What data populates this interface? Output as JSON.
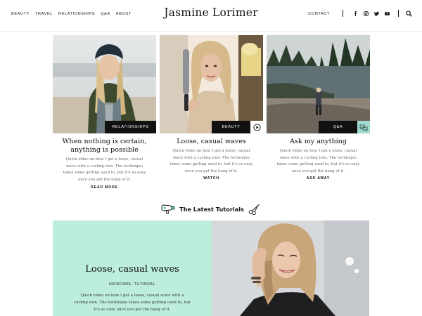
{
  "header": {
    "nav": [
      "Beauty",
      "Travel",
      "Relationships",
      "Q&A",
      "About"
    ],
    "site_title": "Jasmine Lorimer",
    "contact_label": "Contact",
    "social_icons": [
      "facebook-icon",
      "instagram-icon",
      "twitter-icon",
      "youtube-icon"
    ]
  },
  "cards": [
    {
      "title": "When nothing is certain, anything is possible",
      "category": "Relationships",
      "description": "Quick video on how I get a loose, casual wave with a curling iron. The technique takes some getting used to, but it's so easy once you get the hang of it.",
      "link_label": "Read More"
    },
    {
      "title": "Loose, casual waves",
      "category": "Beauty",
      "description": "Quick video on how I get a loose, casual wave with a curling iron. The technique takes some getting used to, but it's so easy once you get the hang of it.",
      "link_label": "Watch",
      "badge_icon": "play-icon"
    },
    {
      "title": "Ask my anything",
      "category": "Q&A",
      "description": "Quick video on how I get a loose, casual wave with a curling iron. The technique takes some getting used to, but it's so easy once you get the hang of it.",
      "link_label": "Ask Away",
      "badge_icon": "chat-icon"
    }
  ],
  "latest": {
    "title": "The Latest Tutorials",
    "left_icon": "hair-dryer-icon",
    "right_icon": "scissors-icon"
  },
  "feature": {
    "title": "Loose, casual waves",
    "categories": "Haircare, Tutorial",
    "description": "Quick video on how I get a loose, casual wave with a curling iron. The technique takes some getting used to, but it's so easy once you get the hang of it."
  },
  "colors": {
    "feature_bg": "#bdeedc",
    "tag_bg": "#111111",
    "chat_badge": "#9fd9cf"
  }
}
